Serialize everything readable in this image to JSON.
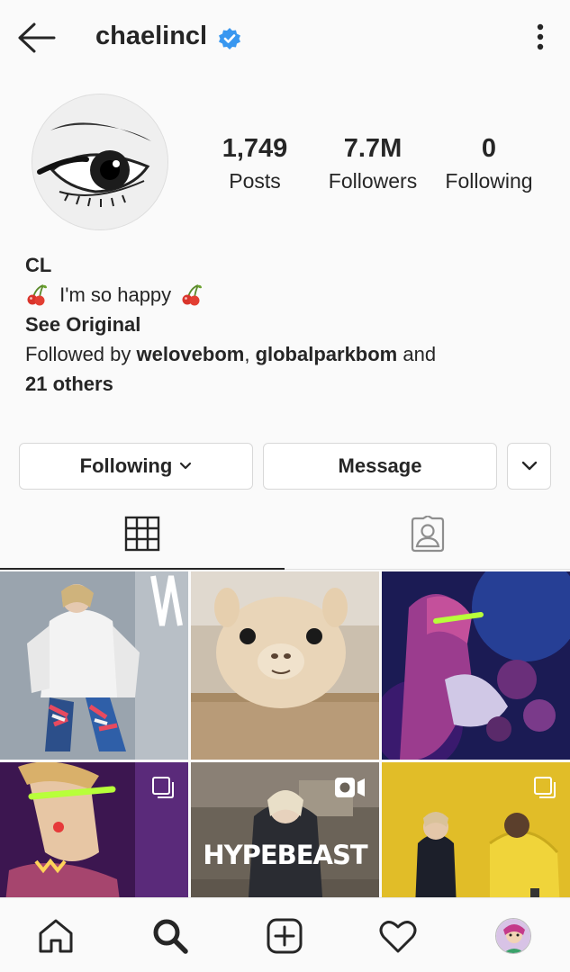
{
  "header": {
    "username": "chaelincl",
    "verified": true
  },
  "stats": {
    "posts_count": "1,749",
    "posts_label": "Posts",
    "followers_count": "7.7M",
    "followers_label": "Followers",
    "following_count": "0",
    "following_label": "Following"
  },
  "bio": {
    "name": "CL",
    "text": "I'm so happy",
    "emoji": "cherries",
    "see_original": "See Original",
    "followed_by_prefix": "Followed by ",
    "followed_by_user1": "welovebom",
    "separator": ", ",
    "followed_by_user2": "globalparkbom",
    "and_text": " and",
    "others": "21 others"
  },
  "actions": {
    "following_label": "Following",
    "message_label": "Message"
  },
  "tabs": {
    "active": "grid",
    "items": [
      "grid",
      "tagged"
    ]
  },
  "grid_posts": [
    {
      "type": "photo"
    },
    {
      "type": "photo"
    },
    {
      "type": "photo"
    },
    {
      "type": "carousel"
    },
    {
      "type": "igtv",
      "overlay_text": "HYPEBEAST"
    },
    {
      "type": "carousel"
    }
  ],
  "bottom_nav": [
    "home-icon",
    "search-icon",
    "add-post-icon",
    "activity-heart-icon",
    "profile-avatar"
  ],
  "colors": {
    "text": "#262626",
    "verified_blue": "#3897f0",
    "border": "#d8d8d8",
    "background": "#fafafa"
  }
}
